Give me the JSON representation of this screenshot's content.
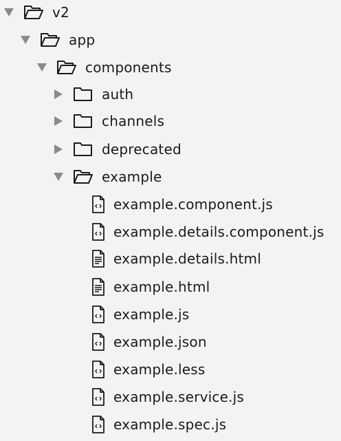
{
  "tree": {
    "root": {
      "label": "v2",
      "expanded": true,
      "icon": "folder-open-icon"
    },
    "app": {
      "label": "app",
      "expanded": true,
      "icon": "folder-open-icon"
    },
    "components": {
      "label": "components",
      "expanded": true,
      "icon": "folder-open-icon"
    },
    "folders": [
      {
        "label": "auth",
        "expanded": false,
        "icon": "folder-icon"
      },
      {
        "label": "channels",
        "expanded": false,
        "icon": "folder-icon"
      },
      {
        "label": "deprecated",
        "expanded": false,
        "icon": "folder-icon"
      },
      {
        "label": "example",
        "expanded": true,
        "icon": "folder-open-icon"
      }
    ],
    "files": [
      {
        "label": "example.component.js",
        "icon": "code-file-icon"
      },
      {
        "label": "example.details.component.js",
        "icon": "code-file-icon"
      },
      {
        "label": "example.details.html",
        "icon": "text-file-icon"
      },
      {
        "label": "example.html",
        "icon": "text-file-icon"
      },
      {
        "label": "example.js",
        "icon": "code-file-icon"
      },
      {
        "label": "example.json",
        "icon": "code-file-icon"
      },
      {
        "label": "example.less",
        "icon": "code-file-icon"
      },
      {
        "label": "example.service.js",
        "icon": "code-file-icon"
      },
      {
        "label": "example.spec.js",
        "icon": "code-file-icon"
      }
    ]
  },
  "colors": {
    "background": "#f3f3f3",
    "caret": "#8a8a8a",
    "icon": "#1a1a1a",
    "text": "#1a1a1a"
  }
}
